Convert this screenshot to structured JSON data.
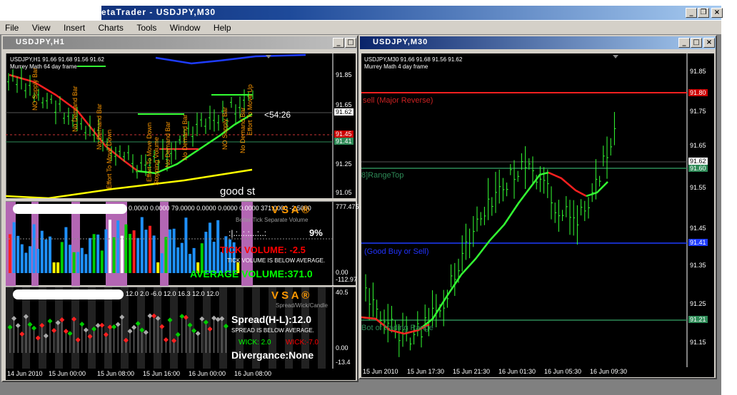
{
  "app": {
    "title": "etaTrader - USDJPY,M30",
    "menu": [
      "File",
      "View",
      "Insert",
      "Charts",
      "Tools",
      "Window",
      "Help"
    ]
  },
  "left_window": {
    "title": "USDJPY,H1",
    "header_line": "USDJPY,H1  91.66 91.68 91.56 91.62",
    "indicator_name": "Murrey Math 64 day frame",
    "price_scale": [
      "91.85",
      "91.65",
      "91.62",
      "91.45",
      "91.41",
      "91.25",
      "91.05"
    ],
    "countdown": "<54:26",
    "good_text": "good st",
    "bar_labels": [
      "NO Supply Bar",
      "No Demand Bar",
      "No Demand Bar",
      "Effort To Move Down",
      "Effort To Move Down",
      "Stopping Volume",
      "No Demand Bar",
      "No Demand Bar",
      "NO Supply Bar",
      "No Demand Bar",
      "Effort To Move Up"
    ],
    "vsa1": {
      "header_values": "0.0000 0.0000 79.0000 0.0000 0.0000 0.0000 371.0000 -2.5000",
      "logo": "V S A ®",
      "subtitle": "Better Tick Separate Volume",
      "dots": ":|.:..:.:...:..:",
      "percent": "9%",
      "tick_volume": "TICK VOLUME: -2.5",
      "below_avg": "TICK VOLUME IS BELOW AVERAGE.",
      "average_volume": "AVERAGE VOLUME:371.0",
      "scale": [
        "777.475",
        "0.00",
        "-112.97"
      ]
    },
    "vsa2": {
      "header_values": "12.0 2.0 -6.0 12.0 16.3 12.0 12.0",
      "logo": "V S A ®",
      "subtitle": "Spread/Wick/Candle",
      "spread": "Spread(H-L):12.0",
      "below_avg": "SPREAD IS BELOW AVERAGE.",
      "wick_pos": "WICK: 2.0",
      "wick_neg": "WICK:-7.0",
      "divergance": "Divergance:None",
      "scale": [
        "40.5",
        "0.00",
        "-13.4"
      ]
    },
    "time_axis": [
      "14 Jun 2010",
      "15 Jun 00:00",
      "15 Jun 08:00",
      "15 Jun 16:00",
      "16 Jun 00:00",
      "16 Jun 08:00"
    ]
  },
  "right_window": {
    "title": "USDJPY,M30",
    "header_line": "USDJPY,M30  91.66 91.68 91.56 91.62",
    "indicator_name": "Murrey Math 4 day frame",
    "price_scale": [
      "91.85",
      "91.80",
      "91.75",
      "91.65",
      "91.62",
      "91.60",
      "91.55",
      "91.45",
      "91.41",
      "91.35",
      "91.25",
      "91.21",
      "91.15"
    ],
    "level_labels": {
      "sell": "sell (Major Reverse)",
      "range_top": "8]RangeTop",
      "good_buy": "(Good Buy or Sell)",
      "bot": "Bot of trading Range"
    },
    "time_axis": [
      "15 Jun 2010",
      "15 Jun 17:30",
      "15 Jun 21:30",
      "16 Jun 01:30",
      "16 Jun 05:30",
      "16 Jun 09:30"
    ]
  },
  "colors": {
    "red": "#ff0000",
    "green": "#00ff00",
    "dark_green": "#2e8b57",
    "blue": "#0000ff",
    "magenta": "#cc66cc",
    "orange": "#ff9900",
    "yellow": "#ffff00"
  }
}
